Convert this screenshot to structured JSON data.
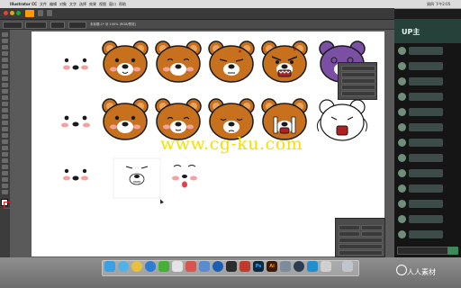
{
  "menubar": {
    "apple_icon": "",
    "app_name": "Illustrator CC",
    "items": [
      "文件",
      "编辑",
      "对象",
      "文字",
      "选择",
      "效果",
      "视图",
      "窗口",
      "帮助"
    ],
    "status_time": "周四 下午2:05"
  },
  "document": {
    "tab_title": "未标题-1* @ 100% (RGB/预览)"
  },
  "watermark": "www.cg-ku.com",
  "side_panel": {
    "header_text": "UP主"
  },
  "bottom_logo": "人人素材",
  "colors": {
    "bear_fill": "#c7711e",
    "bear_outline": "#1a1a1a",
    "cheek": "#f2a3a0",
    "muzzle": "#ffffff",
    "bear_purple": "#7a4fa4",
    "watermark": "#f4e000"
  },
  "dock": {
    "icons": [
      "finder-icon",
      "safari-icon",
      "chrome-icon",
      "qq-icon",
      "wechat-icon",
      "photos-icon",
      "mail-icon",
      "keynote-icon",
      "browser-icon",
      "k-icon",
      "launchpad-icon",
      "photoshop-icon",
      "illustrator-icon",
      "system-icon",
      "quicktime-icon",
      "airdrop-icon",
      "preview-icon",
      "trash-icon"
    ],
    "labels": {
      "photoshop": "Ps",
      "illustrator": "Ai"
    }
  }
}
